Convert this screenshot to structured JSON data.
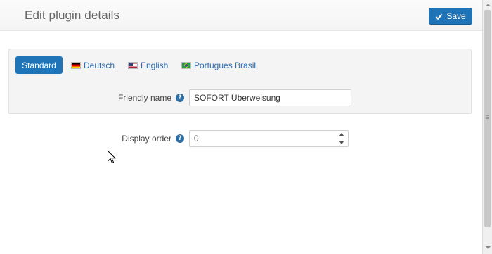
{
  "header": {
    "title": "Edit plugin details",
    "save_label": "Save"
  },
  "tabs": {
    "standard": "Standard",
    "items": [
      {
        "label": "Deutsch",
        "flag": "de-flag-icon"
      },
      {
        "label": "English",
        "flag": "us-flag-icon"
      },
      {
        "label": "Portugues Brasil",
        "flag": "br-flag-icon"
      }
    ]
  },
  "form": {
    "friendly_name": {
      "label": "Friendly name",
      "value": "SOFORT Überweisung"
    },
    "display_order": {
      "label": "Display order",
      "value": "0"
    }
  },
  "colors": {
    "primary": "#1f73b7",
    "link": "#2a6fb5",
    "help": "#2f6ea3"
  }
}
